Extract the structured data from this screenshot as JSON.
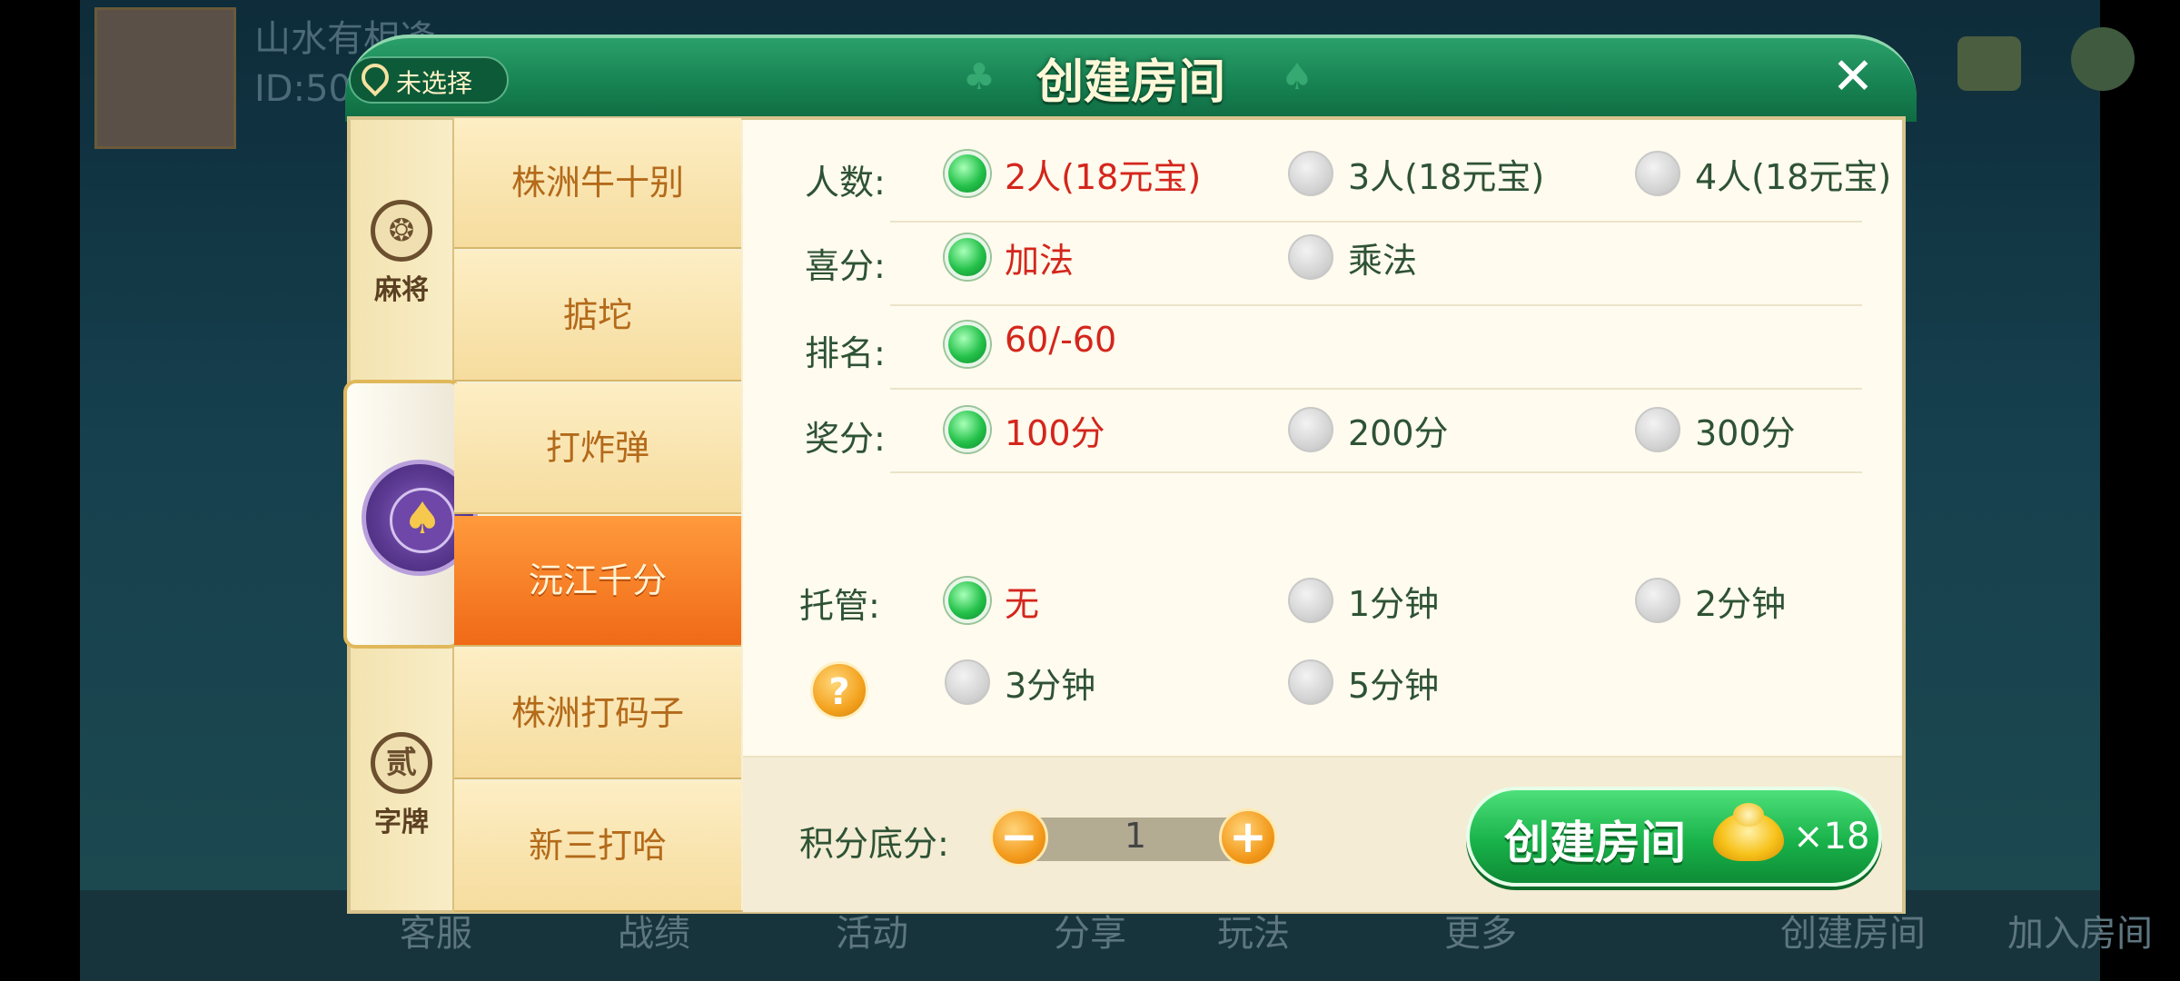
{
  "background": {
    "player_name": "山水有相逢",
    "player_id": "ID:50",
    "bottom_bar": [
      "客服",
      "战绩",
      "活动",
      "分享",
      "玩法",
      "更多",
      "创建房间",
      "加入房间"
    ]
  },
  "dialog": {
    "title": "创建房间",
    "location_label": "未选择",
    "close_icon": "close-icon"
  },
  "categories": [
    {
      "label": "麻将",
      "icon": "mahjong-icon",
      "glyph": "❂"
    },
    {
      "label": "",
      "icon": "poker-chip-spade-icon",
      "glyph": "♠",
      "active": true
    },
    {
      "label": "字牌",
      "icon": "zipai-icon",
      "glyph": "贰"
    }
  ],
  "games": [
    "株洲牛十别",
    "掂坨",
    "打炸弹",
    "沅江千分",
    "株洲打码子",
    "新三打哈"
  ],
  "active_game_index": 3,
  "rules": {
    "players": {
      "label": "人数:",
      "options": [
        "2人(18元宝)",
        "3人(18元宝)",
        "4人(18元宝)"
      ],
      "selected": 0
    },
    "xi_score": {
      "label": "喜分:",
      "options": [
        "加法",
        "乘法"
      ],
      "selected": 0
    },
    "ranking": {
      "label": "排名:",
      "options": [
        "60/-60"
      ],
      "selected": 0
    },
    "bonus": {
      "label": "奖分:",
      "options": [
        "100分",
        "200分",
        "300分"
      ],
      "selected": 0
    },
    "auto_play": {
      "label": "托管:",
      "options": [
        "无",
        "1分钟",
        "2分钟",
        "3分钟",
        "5分钟"
      ],
      "selected": 0
    }
  },
  "help_glyph": "?",
  "base_score": {
    "label": "积分底分:",
    "value": "1",
    "minus": "−",
    "plus": "+"
  },
  "create_button": {
    "label": "创建房间",
    "cost": "×18",
    "icon": "gold-ingot-icon"
  },
  "colors": {
    "header_green": "#168050",
    "selected_text": "#d4261c",
    "label_text": "#2e5234",
    "active_tab": "#f06a16",
    "create_green": "#19b24a"
  }
}
